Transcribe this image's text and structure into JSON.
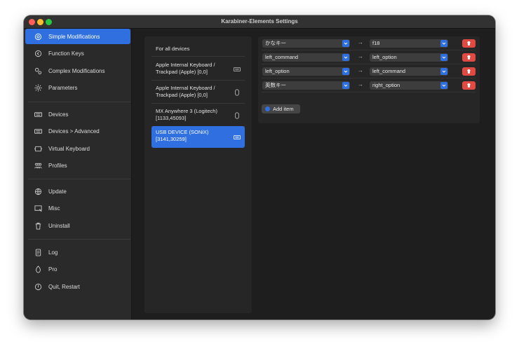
{
  "window": {
    "title": "Karabiner-Elements Settings"
  },
  "sidebar": {
    "items": [
      {
        "label": "Simple Modifications",
        "icon": "simple-modifications-icon",
        "selected": true
      },
      {
        "label": "Function Keys",
        "icon": "function-keys-icon"
      },
      {
        "label": "Complex Modifications",
        "icon": "complex-modifications-icon"
      },
      {
        "label": "Parameters",
        "icon": "parameters-icon"
      },
      {
        "label": "Devices",
        "icon": "devices-icon"
      },
      {
        "label": "Devices > Advanced",
        "icon": "devices-advanced-icon"
      },
      {
        "label": "Virtual Keyboard",
        "icon": "virtual-keyboard-icon"
      },
      {
        "label": "Profiles",
        "icon": "profiles-icon"
      },
      {
        "label": "Update",
        "icon": "update-icon"
      },
      {
        "label": "Misc",
        "icon": "misc-icon"
      },
      {
        "label": "Uninstall",
        "icon": "trash-icon"
      },
      {
        "label": "Log",
        "icon": "log-icon"
      },
      {
        "label": "Pro",
        "icon": "pro-icon"
      },
      {
        "label": "Quit, Restart",
        "icon": "power-icon"
      }
    ]
  },
  "devices": [
    {
      "label_line1": "For all devices",
      "label_line2": "",
      "icon": ""
    },
    {
      "label_line1": "Apple Internal Keyboard /",
      "label_line2": "Trackpad (Apple) [0,0]",
      "icon": "keyboard-icon"
    },
    {
      "label_line1": "Apple Internal Keyboard /",
      "label_line2": "Trackpad (Apple) [0,0]",
      "icon": "mouse-icon"
    },
    {
      "label_line1": "MX Anywhere 3 (Logitech)",
      "label_line2": "[1133,45093]",
      "icon": "mouse-icon"
    },
    {
      "label_line1": "USB DEVICE (SONiX)",
      "label_line2": "[3141,30259]",
      "icon": "keyboard-icon",
      "selected": true
    }
  ],
  "modifications": [
    {
      "from": "かなキー",
      "to": "f18"
    },
    {
      "from": "left_command",
      "to": "left_option"
    },
    {
      "from": "left_option",
      "to": "left_command"
    },
    {
      "from": "英数キー",
      "to": "right_option"
    }
  ],
  "arrow_glyph": "→",
  "add_item_label": "Add item",
  "colors": {
    "accent": "#2f6fe0",
    "delete": "#e04a43"
  }
}
